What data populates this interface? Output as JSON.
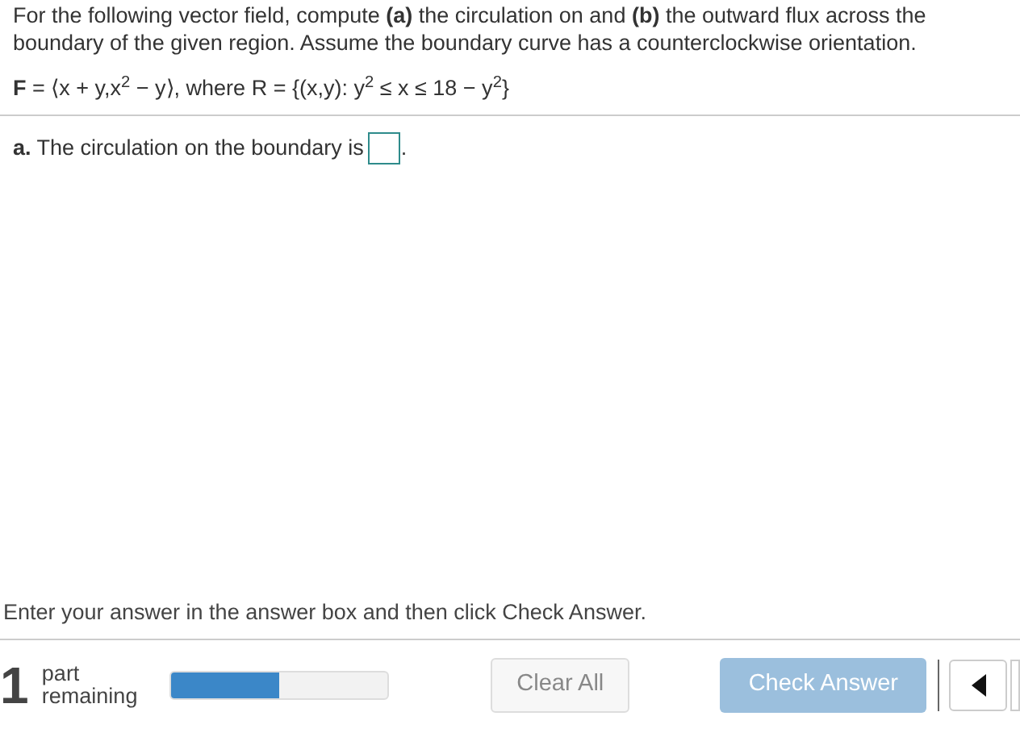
{
  "problem": {
    "instructions": "For the following vector field, compute **(a)** the circulation on and **(b)** the outward flux across the boundary of the given region. Assume the boundary curve has a counterclockwise orientation.",
    "formula": "**F** = ⟨x + y,x$^{2}$ − y⟩, where R = {(x,y): y$^{2}$ ≤ x ≤ 18 − y$^{2}$}"
  },
  "question": {
    "prompt": "**a.** The circulation on the boundary is",
    "after": "."
  },
  "hint": "Enter your answer in the answer box and then click Check Answer.",
  "footer": {
    "count": "1",
    "count_label": "part remaining",
    "progress": {
      "level": 0.5
    },
    "buttons": [
      {
        "label": "Clear All",
        "kind": "secondary",
        "disabled": false
      },
      {
        "label": "Check Answer",
        "kind": "primary",
        "disabled": true
      }
    ]
  }
}
